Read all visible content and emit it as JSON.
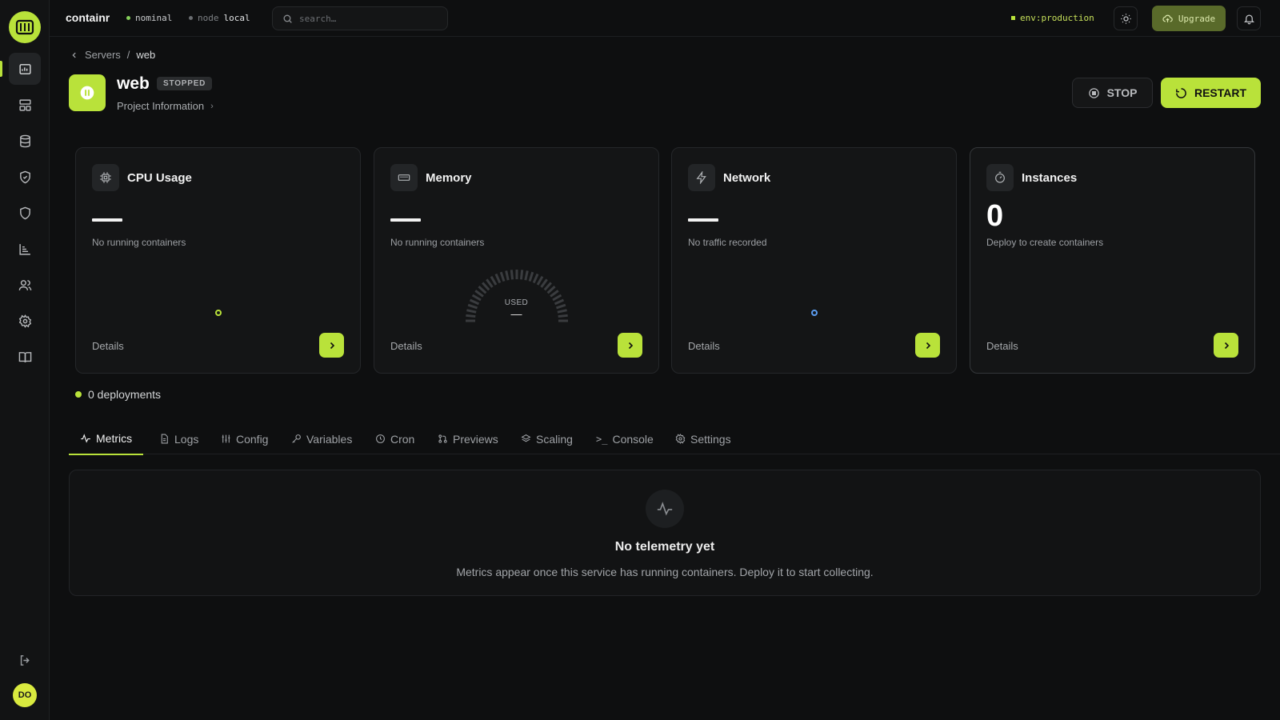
{
  "app": {
    "brand": "containr",
    "status": "nominal",
    "node_label": "node",
    "node_value": "local"
  },
  "search": {
    "placeholder": "search…"
  },
  "env": {
    "label": "env:production"
  },
  "upgrade": {
    "label": "Upgrade"
  },
  "user": {
    "initials": "DO"
  },
  "sidebar": {
    "items": [
      {
        "icon": "dashboard-icon",
        "active": true
      },
      {
        "icon": "templates-icon"
      },
      {
        "icon": "database-icon"
      },
      {
        "icon": "shield-check-icon"
      },
      {
        "icon": "shield-icon"
      },
      {
        "icon": "analytics-icon"
      },
      {
        "icon": "users-icon"
      },
      {
        "icon": "settings-icon"
      },
      {
        "icon": "docs-icon"
      }
    ]
  },
  "breadcrumb": {
    "parent": "Servers",
    "separator": "/",
    "current": "web"
  },
  "service": {
    "name": "web",
    "status": "STOPPED",
    "link": "Project Information"
  },
  "actions": {
    "stop": "STOP",
    "restart": "RESTART"
  },
  "cards": {
    "cpu": {
      "title": "CPU Usage",
      "subtitle": "No running containers",
      "details": "Details"
    },
    "memory": {
      "title": "Memory",
      "subtitle": "No running containers",
      "details": "Details",
      "gauge_label": "USED",
      "gauge_value": "—"
    },
    "network": {
      "title": "Network",
      "subtitle": "No traffic recorded",
      "details": "Details"
    },
    "instances": {
      "title": "Instances",
      "value": "0",
      "subtitle": "Deploy to create containers",
      "details": "Details"
    }
  },
  "deployments": {
    "label": "0 deployments"
  },
  "tabs": [
    "Metrics",
    "Logs",
    "Config",
    "Variables",
    "Cron",
    "Previews",
    "Scaling",
    "Console",
    "Settings"
  ],
  "empty": {
    "title": "No telemetry yet",
    "text": "Metrics appear once this service has running containers. Deploy it to start collecting."
  },
  "colors": {
    "accent": "#b9e23a",
    "bg": "#0e0f10",
    "card": "#141516",
    "network_dot": "#5b9cf0"
  }
}
